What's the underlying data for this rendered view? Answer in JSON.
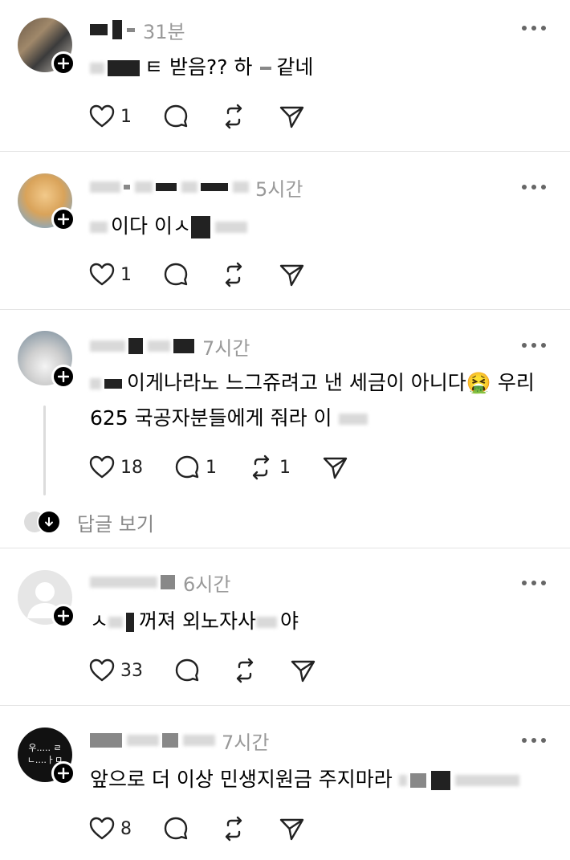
{
  "posts": [
    {
      "time": "31분",
      "text_a": "ㅌ 받음?? 하",
      "text_b": "같네",
      "likes": "1",
      "replies": "",
      "reposts": ""
    },
    {
      "time": "5시간",
      "text_a": "이다 이ㅅ",
      "likes": "1",
      "replies": "",
      "reposts": ""
    },
    {
      "time": "7시간",
      "text_a": "이게나라노 느그쥬려고 낸 세금이 아니다🤮 우리",
      "text_b": "625 국공자분들에게 줘라 이",
      "likes": "18",
      "replies": "1",
      "reposts": "1",
      "view_replies": "답글 보기"
    },
    {
      "time": "6시간",
      "text_a": "ㅅ",
      "text_b": "꺼져 외노자사",
      "text_c": "야",
      "likes": "33",
      "replies": "",
      "reposts": ""
    },
    {
      "time": "7시간",
      "text_a": "앞으로 더 이상 민생지원금 주지마라",
      "avatar_text_1": "우..... ㄹ",
      "avatar_text_2": "ㄴ....ㅏㅁ",
      "likes": "8",
      "replies": "",
      "reposts": ""
    }
  ],
  "icons": {
    "like": "heart-icon",
    "reply": "comment-icon",
    "repost": "repost-icon",
    "share": "send-icon",
    "follow": "plus-icon",
    "more": "more-icon",
    "expand": "arrow-down-icon"
  },
  "colors": {
    "badge": "#000000",
    "muted": "#999999",
    "divider": "#e3e3e3"
  }
}
